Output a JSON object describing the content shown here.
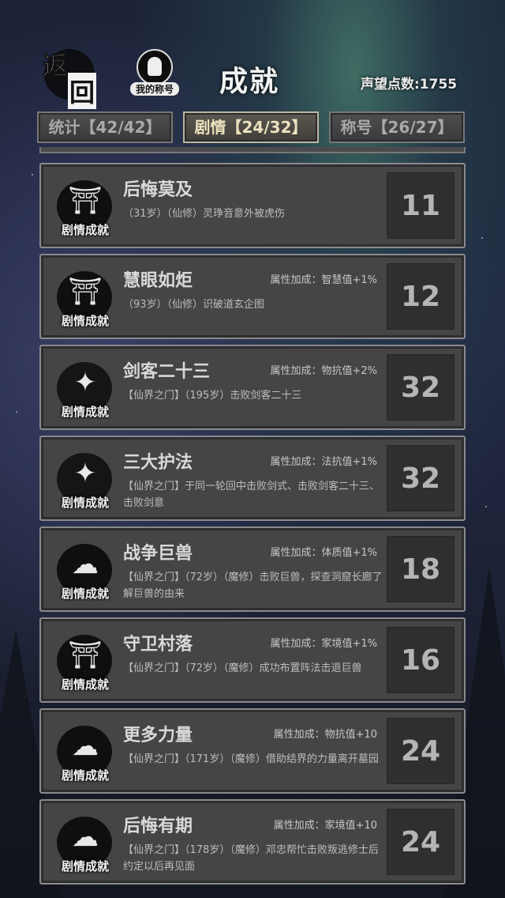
{
  "header": {
    "back_label_1": "返",
    "back_label_2": "回",
    "title_badge_label": "我的称号",
    "page_title": "成就",
    "reputation": "声望点数:1755"
  },
  "tabs": [
    {
      "label": "统计【42/42】",
      "active": false
    },
    {
      "label": "剧情【24/32】",
      "active": true
    },
    {
      "label": "称号【26/27】",
      "active": false
    }
  ],
  "achievements": [
    {
      "icon": "gate-emblem-icon",
      "icon_label": "剧情成就",
      "title": "后悔莫及",
      "bonus": "",
      "desc": "（31岁）（仙修）灵琤音意外被虎伤",
      "score": "11"
    },
    {
      "icon": "gate-emblem-icon",
      "icon_label": "剧情成就",
      "title": "慧眼如炬",
      "bonus": "属性加成：智慧值+1%",
      "desc": "（93岁）（仙修）识破道玄企图",
      "score": "12"
    },
    {
      "icon": "winged-emblem-icon",
      "icon_label": "剧情成就",
      "title": "剑客二十三",
      "bonus": "属性加成：物抗值+2%",
      "desc": "【仙界之门】（195岁）击败剑客二十三",
      "score": "32"
    },
    {
      "icon": "winged-emblem-icon",
      "icon_label": "剧情成就",
      "title": "三大护法",
      "bonus": "属性加成：法抗值+1%",
      "desc": "【仙界之门】于同一轮回中击败剑式、击败剑客二十三、击败剑意",
      "score": "32"
    },
    {
      "icon": "cloud-emblem-icon",
      "icon_label": "剧情成就",
      "title": "战争巨兽",
      "bonus": "属性加成：体质值+1%",
      "desc": "【仙界之门】（72岁）（魔修）击败巨兽，探查洞窟长廊了解巨兽的由来",
      "score": "18"
    },
    {
      "icon": "gate-emblem-icon",
      "icon_label": "剧情成就",
      "title": "守卫村落",
      "bonus": "属性加成：家境值+1%",
      "desc": "【仙界之门】（72岁）（魔修）成功布置阵法击退巨兽",
      "score": "16"
    },
    {
      "icon": "cloud-emblem-icon",
      "icon_label": "剧情成就",
      "title": "更多力量",
      "bonus": "属性加成：物抗值+10",
      "desc": "【仙界之门】（171岁）（魔修）借助结界的力量离开墓园",
      "score": "24"
    },
    {
      "icon": "cloud-emblem-icon",
      "icon_label": "剧情成就",
      "title": "后悔有期",
      "bonus": "属性加成：家境值+10",
      "desc": "【仙界之门】（178岁）（魔修）邓忠帮忙击败叛逃修士后约定以后再见面",
      "score": "24"
    }
  ]
}
